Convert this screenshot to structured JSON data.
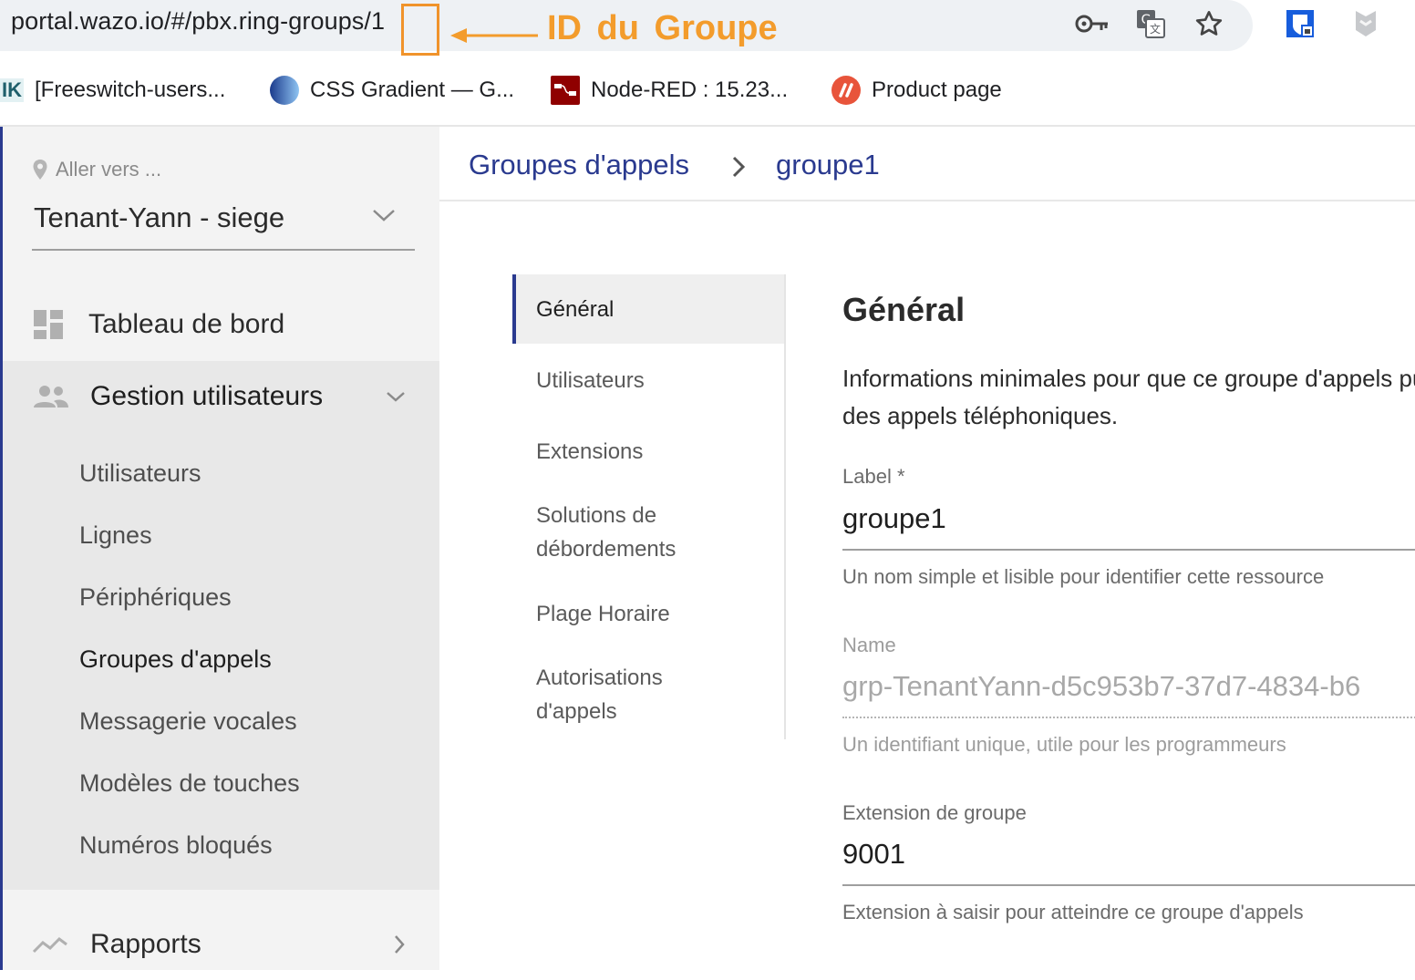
{
  "browser": {
    "url": "portal.wazo.io/#/pbx.ring-groups/1",
    "annotation": "ID du  Groupe",
    "icons": [
      "key-icon",
      "translate-icon",
      "star-icon",
      "bitwarden-icon",
      "extension-shield-icon"
    ],
    "bookmarks": [
      {
        "label": "[Freeswitch-users...",
        "favicon_text": "IK"
      },
      {
        "label": "CSS Gradient — G..."
      },
      {
        "label": "Node-RED : 15.23..."
      },
      {
        "label": "Product page"
      }
    ]
  },
  "sidebar": {
    "goto_label": "Aller vers ...",
    "tenant": "Tenant-Yann - siege",
    "nav": {
      "dashboard": "Tableau de bord",
      "user_management": "Gestion utilisateurs",
      "reports": "Rapports"
    },
    "user_management_items": [
      "Utilisateurs",
      "Lignes",
      "Périphériques",
      "Groupes d'appels",
      "Messagerie vocales",
      "Modèles de touches",
      "Numéros bloqués"
    ],
    "active_item": "Groupes d'appels"
  },
  "breadcrumb": {
    "parent": "Groupes d'appels",
    "current": "groupe1"
  },
  "subnav": {
    "items": [
      "Général",
      "Utilisateurs",
      "Extensions",
      "Solutions de débordements",
      "Plage Horaire",
      "Autorisations d'appels"
    ],
    "active": "Général"
  },
  "form": {
    "title": "Général",
    "description": "Informations minimales pour que ce groupe d'appels puisse recevoir des appels téléphoniques.",
    "label_field": {
      "label": "Label *",
      "value": "groupe1",
      "help": "Un nom simple et lisible pour identifier cette ressource"
    },
    "name_field": {
      "label": "Name",
      "value": "grp-TenantYann-d5c953b7-37d7-4834-b6",
      "help": "Un identifiant unique, utile pour les programmeurs"
    },
    "extension_field": {
      "label": "Extension de groupe",
      "value": "9001",
      "help": "Extension à saisir pour atteindre ce groupe d'appels"
    }
  },
  "colors": {
    "accent": "#2a3a8f",
    "annotation": "#f39c2c",
    "sidebar_bg": "#f3f3f3",
    "sidebar_section_bg": "#e8e8e8"
  }
}
